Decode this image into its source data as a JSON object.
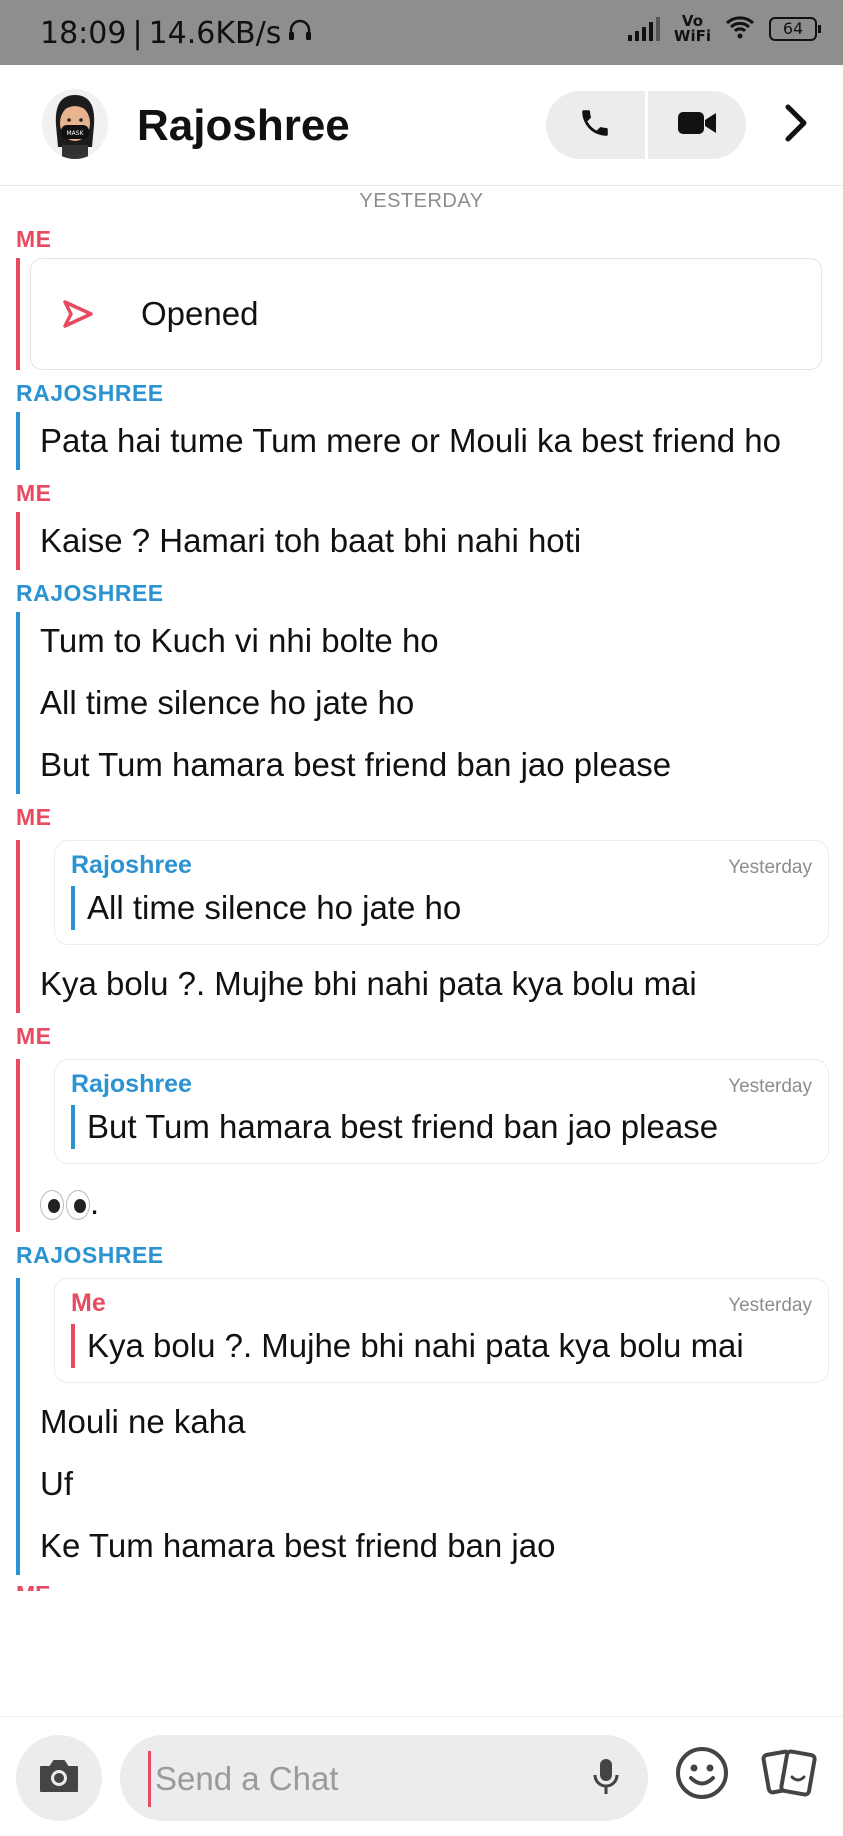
{
  "status_bar": {
    "time": "18:09",
    "speed": "14.6KB/s",
    "network_label": "Vo\nWiFi",
    "battery": "64"
  },
  "header": {
    "contact_name": "Rajoshree",
    "avatar_icon": "bitmoji-avatar-icon",
    "call_icon": "phone-icon",
    "video_icon": "video-camera-icon",
    "more_icon": "chevron-right-icon"
  },
  "chat": {
    "day_label": "YESTERDAY",
    "blocks": {
      "b1": {
        "sender": "ME",
        "opened_label": "Opened"
      },
      "b2": {
        "sender": "RAJOSHREE",
        "m1": "Pata hai tume Tum mere or Mouli ka best friend ho"
      },
      "b3": {
        "sender": "ME",
        "m1": "Kaise ? Hamari toh baat bhi nahi hoti"
      },
      "b4": {
        "sender": "RAJOSHREE",
        "m1": "Tum to Kuch vi nhi bolte ho",
        "m2": "All time silence ho jate ho",
        "m3": "But Tum hamara best friend ban jao please"
      },
      "b5": {
        "sender": "ME",
        "quote": {
          "name": "Rajoshree",
          "time": "Yesterday",
          "text": "All time silence ho jate ho"
        },
        "m1": "Kya bolu ?. Mujhe bhi nahi pata kya bolu mai"
      },
      "b6": {
        "sender": "ME",
        "quote": {
          "name": "Rajoshree",
          "time": "Yesterday",
          "text": "But Tum hamara best friend ban jao please"
        },
        "m1_suffix": "."
      },
      "b7": {
        "sender": "RAJOSHREE",
        "quote": {
          "name": "Me",
          "time": "Yesterday",
          "text": "Kya bolu ?. Mujhe bhi nahi pata kya bolu mai"
        },
        "m1": "Mouli ne kaha",
        "m2": "Uf",
        "m3": "Ke Tum hamara best friend ban jao"
      },
      "b8": {
        "sender": "ME"
      }
    }
  },
  "composer": {
    "placeholder": "Send a Chat",
    "camera_icon": "camera-icon",
    "mic_icon": "microphone-icon",
    "emoji_icon": "smiley-icon",
    "cards_icon": "cards-icon"
  },
  "colors": {
    "me": "#e84a5f",
    "them": "#2b93d1",
    "statusbar": "#8e8e8e"
  }
}
